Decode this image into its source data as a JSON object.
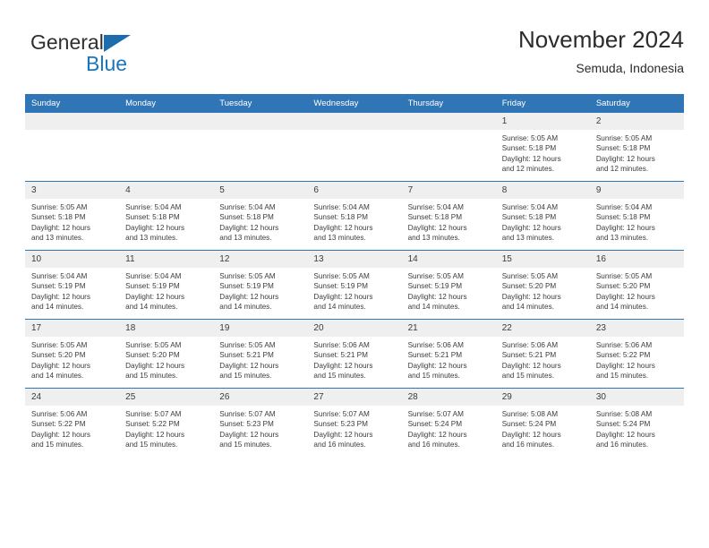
{
  "brand": {
    "name_part1": "General",
    "name_part2": "Blue",
    "triangle_icon": "triangle-icon",
    "accent_color": "#1b75bb"
  },
  "header": {
    "title": "November 2024",
    "subtitle": "Semuda, Indonesia"
  },
  "theme": {
    "header_bg": "#3075b5",
    "daynum_bg": "#efefef",
    "text_color": "#3b3b3b"
  },
  "weekday_headers": [
    "Sunday",
    "Monday",
    "Tuesday",
    "Wednesday",
    "Thursday",
    "Friday",
    "Saturday"
  ],
  "labels": {
    "sunrise_prefix": "Sunrise:",
    "sunset_prefix": "Sunset:",
    "daylight_prefix": "Daylight:"
  },
  "weeks": [
    [
      {
        "day": "",
        "sunrise": "",
        "sunset": "",
        "daylight_line1": "",
        "daylight_line2": ""
      },
      {
        "day": "",
        "sunrise": "",
        "sunset": "",
        "daylight_line1": "",
        "daylight_line2": ""
      },
      {
        "day": "",
        "sunrise": "",
        "sunset": "",
        "daylight_line1": "",
        "daylight_line2": ""
      },
      {
        "day": "",
        "sunrise": "",
        "sunset": "",
        "daylight_line1": "",
        "daylight_line2": ""
      },
      {
        "day": "",
        "sunrise": "",
        "sunset": "",
        "daylight_line1": "",
        "daylight_line2": ""
      },
      {
        "day": "1",
        "sunrise": "Sunrise: 5:05 AM",
        "sunset": "Sunset: 5:18 PM",
        "daylight_line1": "Daylight: 12 hours",
        "daylight_line2": "and 12 minutes."
      },
      {
        "day": "2",
        "sunrise": "Sunrise: 5:05 AM",
        "sunset": "Sunset: 5:18 PM",
        "daylight_line1": "Daylight: 12 hours",
        "daylight_line2": "and 12 minutes."
      }
    ],
    [
      {
        "day": "3",
        "sunrise": "Sunrise: 5:05 AM",
        "sunset": "Sunset: 5:18 PM",
        "daylight_line1": "Daylight: 12 hours",
        "daylight_line2": "and 13 minutes."
      },
      {
        "day": "4",
        "sunrise": "Sunrise: 5:04 AM",
        "sunset": "Sunset: 5:18 PM",
        "daylight_line1": "Daylight: 12 hours",
        "daylight_line2": "and 13 minutes."
      },
      {
        "day": "5",
        "sunrise": "Sunrise: 5:04 AM",
        "sunset": "Sunset: 5:18 PM",
        "daylight_line1": "Daylight: 12 hours",
        "daylight_line2": "and 13 minutes."
      },
      {
        "day": "6",
        "sunrise": "Sunrise: 5:04 AM",
        "sunset": "Sunset: 5:18 PM",
        "daylight_line1": "Daylight: 12 hours",
        "daylight_line2": "and 13 minutes."
      },
      {
        "day": "7",
        "sunrise": "Sunrise: 5:04 AM",
        "sunset": "Sunset: 5:18 PM",
        "daylight_line1": "Daylight: 12 hours",
        "daylight_line2": "and 13 minutes."
      },
      {
        "day": "8",
        "sunrise": "Sunrise: 5:04 AM",
        "sunset": "Sunset: 5:18 PM",
        "daylight_line1": "Daylight: 12 hours",
        "daylight_line2": "and 13 minutes."
      },
      {
        "day": "9",
        "sunrise": "Sunrise: 5:04 AM",
        "sunset": "Sunset: 5:18 PM",
        "daylight_line1": "Daylight: 12 hours",
        "daylight_line2": "and 13 minutes."
      }
    ],
    [
      {
        "day": "10",
        "sunrise": "Sunrise: 5:04 AM",
        "sunset": "Sunset: 5:19 PM",
        "daylight_line1": "Daylight: 12 hours",
        "daylight_line2": "and 14 minutes."
      },
      {
        "day": "11",
        "sunrise": "Sunrise: 5:04 AM",
        "sunset": "Sunset: 5:19 PM",
        "daylight_line1": "Daylight: 12 hours",
        "daylight_line2": "and 14 minutes."
      },
      {
        "day": "12",
        "sunrise": "Sunrise: 5:05 AM",
        "sunset": "Sunset: 5:19 PM",
        "daylight_line1": "Daylight: 12 hours",
        "daylight_line2": "and 14 minutes."
      },
      {
        "day": "13",
        "sunrise": "Sunrise: 5:05 AM",
        "sunset": "Sunset: 5:19 PM",
        "daylight_line1": "Daylight: 12 hours",
        "daylight_line2": "and 14 minutes."
      },
      {
        "day": "14",
        "sunrise": "Sunrise: 5:05 AM",
        "sunset": "Sunset: 5:19 PM",
        "daylight_line1": "Daylight: 12 hours",
        "daylight_line2": "and 14 minutes."
      },
      {
        "day": "15",
        "sunrise": "Sunrise: 5:05 AM",
        "sunset": "Sunset: 5:20 PM",
        "daylight_line1": "Daylight: 12 hours",
        "daylight_line2": "and 14 minutes."
      },
      {
        "day": "16",
        "sunrise": "Sunrise: 5:05 AM",
        "sunset": "Sunset: 5:20 PM",
        "daylight_line1": "Daylight: 12 hours",
        "daylight_line2": "and 14 minutes."
      }
    ],
    [
      {
        "day": "17",
        "sunrise": "Sunrise: 5:05 AM",
        "sunset": "Sunset: 5:20 PM",
        "daylight_line1": "Daylight: 12 hours",
        "daylight_line2": "and 14 minutes."
      },
      {
        "day": "18",
        "sunrise": "Sunrise: 5:05 AM",
        "sunset": "Sunset: 5:20 PM",
        "daylight_line1": "Daylight: 12 hours",
        "daylight_line2": "and 15 minutes."
      },
      {
        "day": "19",
        "sunrise": "Sunrise: 5:05 AM",
        "sunset": "Sunset: 5:21 PM",
        "daylight_line1": "Daylight: 12 hours",
        "daylight_line2": "and 15 minutes."
      },
      {
        "day": "20",
        "sunrise": "Sunrise: 5:06 AM",
        "sunset": "Sunset: 5:21 PM",
        "daylight_line1": "Daylight: 12 hours",
        "daylight_line2": "and 15 minutes."
      },
      {
        "day": "21",
        "sunrise": "Sunrise: 5:06 AM",
        "sunset": "Sunset: 5:21 PM",
        "daylight_line1": "Daylight: 12 hours",
        "daylight_line2": "and 15 minutes."
      },
      {
        "day": "22",
        "sunrise": "Sunrise: 5:06 AM",
        "sunset": "Sunset: 5:21 PM",
        "daylight_line1": "Daylight: 12 hours",
        "daylight_line2": "and 15 minutes."
      },
      {
        "day": "23",
        "sunrise": "Sunrise: 5:06 AM",
        "sunset": "Sunset: 5:22 PM",
        "daylight_line1": "Daylight: 12 hours",
        "daylight_line2": "and 15 minutes."
      }
    ],
    [
      {
        "day": "24",
        "sunrise": "Sunrise: 5:06 AM",
        "sunset": "Sunset: 5:22 PM",
        "daylight_line1": "Daylight: 12 hours",
        "daylight_line2": "and 15 minutes."
      },
      {
        "day": "25",
        "sunrise": "Sunrise: 5:07 AM",
        "sunset": "Sunset: 5:22 PM",
        "daylight_line1": "Daylight: 12 hours",
        "daylight_line2": "and 15 minutes."
      },
      {
        "day": "26",
        "sunrise": "Sunrise: 5:07 AM",
        "sunset": "Sunset: 5:23 PM",
        "daylight_line1": "Daylight: 12 hours",
        "daylight_line2": "and 15 minutes."
      },
      {
        "day": "27",
        "sunrise": "Sunrise: 5:07 AM",
        "sunset": "Sunset: 5:23 PM",
        "daylight_line1": "Daylight: 12 hours",
        "daylight_line2": "and 16 minutes."
      },
      {
        "day": "28",
        "sunrise": "Sunrise: 5:07 AM",
        "sunset": "Sunset: 5:24 PM",
        "daylight_line1": "Daylight: 12 hours",
        "daylight_line2": "and 16 minutes."
      },
      {
        "day": "29",
        "sunrise": "Sunrise: 5:08 AM",
        "sunset": "Sunset: 5:24 PM",
        "daylight_line1": "Daylight: 12 hours",
        "daylight_line2": "and 16 minutes."
      },
      {
        "day": "30",
        "sunrise": "Sunrise: 5:08 AM",
        "sunset": "Sunset: 5:24 PM",
        "daylight_line1": "Daylight: 12 hours",
        "daylight_line2": "and 16 minutes."
      }
    ]
  ]
}
